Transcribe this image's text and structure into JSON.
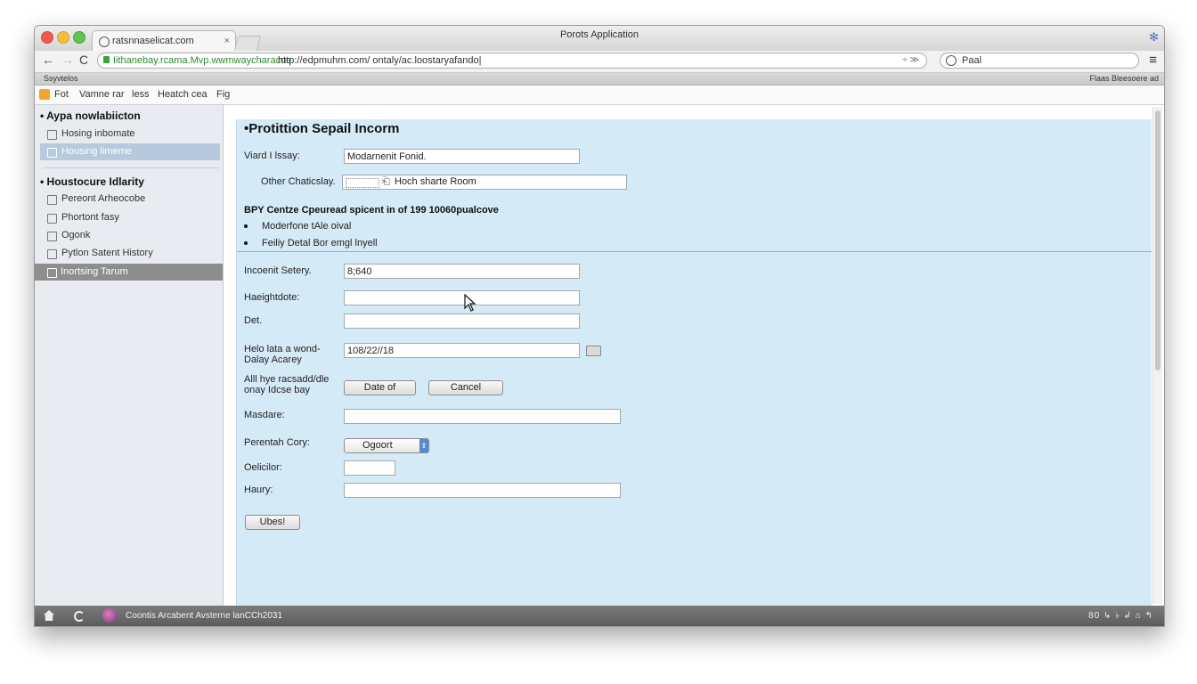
{
  "window": {
    "title": "Porots Application",
    "tab_label": "ratsnnaselicat.com",
    "tab_close": "×"
  },
  "nav": {
    "back": "←",
    "forward": "→",
    "reload": "C",
    "url_green": "Iithanebay.rcama.Mvp.wwmwaycharacoe",
    "url_path": "http://edpmuhm.com/ ontaly/ac.loostaryafando|",
    "url_tools": "÷ ≫",
    "search_text": "Paal",
    "menu": "≡"
  },
  "bookmarks": {
    "left": "Ssyvtelos",
    "right": "Flaas Bleesoere ad"
  },
  "appmenu": [
    "Fot",
    "Vamne rar",
    "less",
    "Heatch cea",
    "Fig"
  ],
  "sidebar": {
    "section1": "• Aypa nowlabiicton",
    "section1_items": [
      "Hosing inbomate",
      "Housing limeme"
    ],
    "section2": "• Houstocure Idlarity",
    "section2_items": [
      "Pereont Arheocobe",
      "Phortont fasy",
      "Ogonk",
      "Pytlon Satent History",
      "Inortsing Tarum"
    ]
  },
  "form": {
    "title": "•Protittion Sepail Incorm",
    "field1_label": "Viard I lssay:",
    "field1_value": "Modarnenit Fonid.",
    "field2_label": "Other Chaticslay.",
    "field2_value": "Hoch sharte Room",
    "section_text": "BPY Centze Cpeuread spicent in of 199 10060pualcove",
    "bullets": [
      "Moderfone tAle oival",
      "Feiliy Detal Bor emgl lnyell"
    ],
    "f3_label": "Incoenit Setery.",
    "f3_value": "8;640",
    "f4_label": "Haeightdote:",
    "f5_label": "Det.",
    "f6_label_1": "Helo lata a wond-",
    "f6_label_2": "Dalay Acarey",
    "f6_value": "108/22//18",
    "f7_label_1": "Alll hye racsadd/dle",
    "f7_label_2": "onay Idcse bay",
    "btn_date": "Date of",
    "btn_cancel": "Cancel",
    "f8_label": "Masdare:",
    "f9_label": "Perentah Cory:",
    "f9_select": "Ogoort",
    "f10_label": "Oelicilor:",
    "f11_label": "Haury:",
    "bottom_btn": "Ubes!"
  },
  "status": {
    "text": "Coontis Arcabent Avsterne lanCCh2031",
    "right": "80 ↳ ♭  ↲  ⌂  ↰"
  }
}
